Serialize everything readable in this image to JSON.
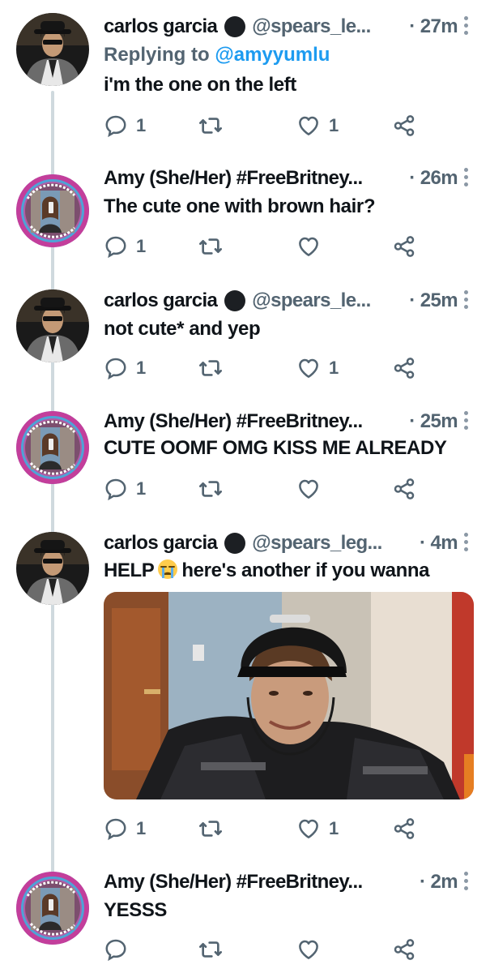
{
  "tweets": [
    {
      "name": "carlos garcia",
      "handle": "@spears_le...",
      "time": "· 27m",
      "replying_prefix": "Replying to ",
      "replying_handle": "@amyyumlu",
      "text": "i'm the one on the left",
      "reply_count": "1",
      "like_count": "1"
    },
    {
      "name": "Amy (She/Her) #FreeBritney...",
      "time": "· 26m",
      "text": "The cute one with brown hair?",
      "reply_count": "1",
      "like_count": ""
    },
    {
      "name": "carlos garcia",
      "handle": "@spears_le...",
      "time": "· 25m",
      "text": "not cute* and yep",
      "reply_count": "1",
      "like_count": "1"
    },
    {
      "name": "Amy (She/Her) #FreeBritney...",
      "time": "· 25m",
      "text": "CUTE OOMF OMG KISS ME ALREADY",
      "reply_count": "1",
      "like_count": ""
    },
    {
      "name": "carlos garcia",
      "handle": "@spears_leg...",
      "time": "· 4m",
      "text_before": "HELP",
      "emoji": "loudly-crying-face-emoji",
      "text_after": "here's another if you wanna",
      "reply_count": "1",
      "like_count": "1"
    },
    {
      "name": "Amy (She/Her) #FreeBritney...",
      "time": "· 2m",
      "text": "YESSS",
      "reply_count": "",
      "like_count": ""
    }
  ],
  "avatar_ring_text": "ISTANBUL SÖZLEŞMESİ YAŞATIR",
  "icons": [
    "reply-icon",
    "retweet-icon",
    "like-icon",
    "share-icon",
    "more-icon"
  ],
  "colors": {
    "thread_line": "#cfd9de",
    "secondary": "#536471",
    "link": "#1d9bf0",
    "text": "#0f1419"
  }
}
